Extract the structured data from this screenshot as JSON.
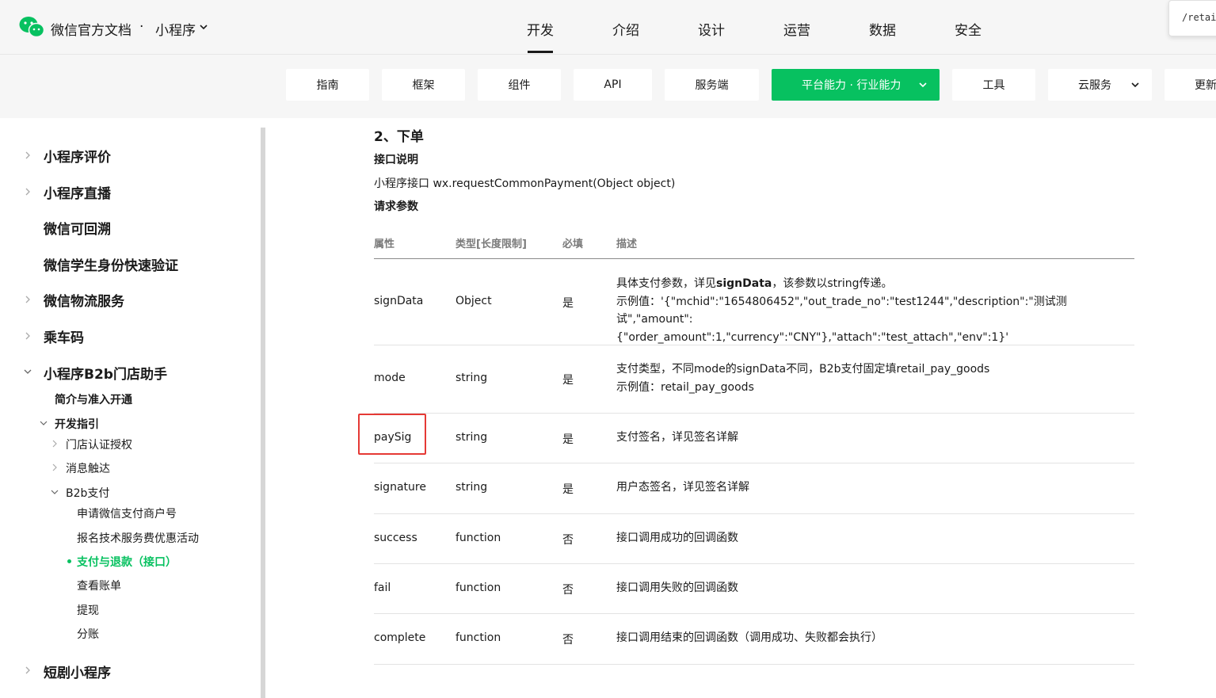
{
  "header": {
    "site_title": "微信官方文档",
    "separator": "·",
    "product": "小程序",
    "nav": [
      "开发",
      "介绍",
      "设计",
      "运营",
      "数据",
      "安全"
    ],
    "active_nav": "开发",
    "corner_tab": "/retail/B"
  },
  "subnav": {
    "items": [
      "指南",
      "框架",
      "组件",
      "API",
      "服务端",
      "平台能力 · 行业能力",
      "工具",
      "云服务",
      "更新"
    ],
    "active": "平台能力 · 行业能力"
  },
  "sidebar": {
    "l1": [
      "小程序评价",
      "小程序直播",
      "微信可回溯",
      "微信学生身份快速验证",
      "微信物流服务",
      "乘车码",
      "小程序B2b门店助手",
      "短剧小程序"
    ],
    "l2": [
      "简介与准入开通",
      "开发指引"
    ],
    "l3": [
      "门店认证授权",
      "消息触达",
      "B2b支付"
    ],
    "l4": [
      "申请微信支付商户号",
      "报名技术服务费优惠活动",
      "支付与退款（接口）",
      "查看账单",
      "提现",
      "分账"
    ],
    "active_item": "支付与退款（接口）"
  },
  "content": {
    "section_title": "2、下单",
    "interface_label": "接口说明",
    "api_signature": "小程序接口 wx.requestCommonPayment(Object object)",
    "params_label": "请求参数",
    "table": {
      "headers": [
        "属性",
        "类型[长度限制]",
        "必填",
        "描述"
      ],
      "rows": [
        {
          "name": "signData",
          "type": "Object",
          "required": "是",
          "desc_prefix": "具体支付参数，详见",
          "desc_bold": "signData",
          "desc_suffix": "，该参数以string传递。",
          "desc_line2": "示例值：'{\"mchid\":\"1654806452\",\"out_trade_no\":\"test1244\",\"description\":\"测试测试\",\"amount\":",
          "desc_line3": "{\"order_amount\":1,\"currency\":\"CNY\"},\"attach\":\"test_attach\",\"env\":1}'"
        },
        {
          "name": "mode",
          "type": "string",
          "required": "是",
          "desc_line1": "支付类型，不同mode的signData不同，B2b支付固定填retail_pay_goods",
          "desc_line2": "示例值：retail_pay_goods"
        },
        {
          "name": "paySig",
          "type": "string",
          "required": "是",
          "desc_line1": "支付签名，详见签名详解"
        },
        {
          "name": "signature",
          "type": "string",
          "required": "是",
          "desc_line1": "用户态签名，详见签名详解"
        },
        {
          "name": "success",
          "type": "function",
          "required": "否",
          "desc_line1": "接口调用成功的回调函数"
        },
        {
          "name": "fail",
          "type": "function",
          "required": "否",
          "desc_line1": "接口调用失败的回调函数"
        },
        {
          "name": "complete",
          "type": "function",
          "required": "否",
          "desc_line1": "接口调用结束的回调函数（调用成功、失败都会执行）"
        }
      ]
    }
  },
  "colors": {
    "accent": "#07c160",
    "highlight": "#e53935",
    "topbar_bg": "#f6f6f6"
  }
}
